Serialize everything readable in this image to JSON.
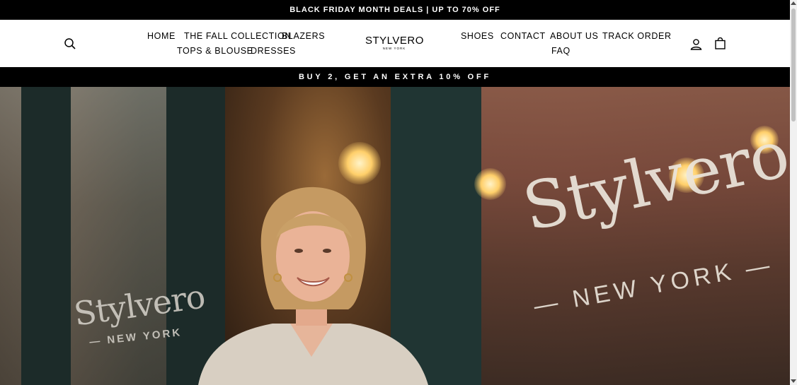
{
  "announcement": {
    "text": "BLACK FRIDAY MONTH DEALS | UP TO 70% OFF"
  },
  "nav": {
    "home": "HOME",
    "fall_collection": "THE FALL COLLECTION",
    "blazers": "BLAZERS",
    "tops_blouse": "TOPS & BLOUSE",
    "dresses": "DRESSES",
    "shoes": "SHOES",
    "contact": "CONTACT",
    "about_us": "ABOUT US",
    "track_order": "TRACK ORDER",
    "faq": "FAQ"
  },
  "logo": {
    "main": "STYLVERO",
    "sub": "NEW YORK"
  },
  "icons": {
    "search": "search-icon",
    "account": "user-icon",
    "cart": "shopping-bag-icon"
  },
  "promo": {
    "text": "BUY 2, GET AN EXTRA 10% OFF"
  },
  "hero": {
    "window_sign_large": "Stylvero",
    "window_sign_large_sub": "— NEW YORK —",
    "window_sign_small": "Stylvero",
    "window_sign_small_sub": "— NEW YORK"
  },
  "colors": {
    "bar_background": "#000000",
    "bar_text": "#ffffff"
  }
}
